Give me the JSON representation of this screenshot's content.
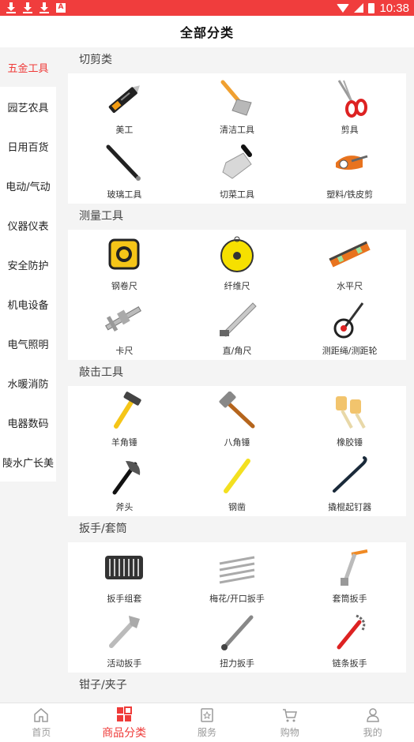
{
  "status_bar": {
    "time": "10:38",
    "notification_icons": [
      "download-icon",
      "download-icon",
      "download-icon",
      "app-a-icon"
    ],
    "accent": "#f03d3d"
  },
  "header": {
    "title": "全部分类"
  },
  "sidebar": {
    "items": [
      {
        "label": "五金工具",
        "active": true
      },
      {
        "label": "园艺农具",
        "active": false
      },
      {
        "label": "日用百货",
        "active": false
      },
      {
        "label": "电动/气动",
        "active": false
      },
      {
        "label": "仪器仪表",
        "active": false
      },
      {
        "label": "安全防护",
        "active": false
      },
      {
        "label": "机电设备",
        "active": false
      },
      {
        "label": "电气照明",
        "active": false
      },
      {
        "label": "水暖消防",
        "active": false
      },
      {
        "label": "电器数码",
        "active": false
      },
      {
        "label": "陵水广长美",
        "active": false
      }
    ]
  },
  "sections": [
    {
      "title": "切剪类",
      "items": [
        {
          "label": "美工",
          "icon": "utility-knife-icon"
        },
        {
          "label": "清洁工具",
          "icon": "scraper-icon"
        },
        {
          "label": "剪具",
          "icon": "scissors-icon"
        },
        {
          "label": "玻璃工具",
          "icon": "glass-cutter-icon"
        },
        {
          "label": "切菜工具",
          "icon": "cleaver-icon"
        },
        {
          "label": "塑料/铁皮剪",
          "icon": "pipe-cutter-icon"
        }
      ]
    },
    {
      "title": "测量工具",
      "items": [
        {
          "label": "钢卷尺",
          "icon": "tape-measure-icon"
        },
        {
          "label": "纤维尺",
          "icon": "fiber-tape-icon"
        },
        {
          "label": "水平尺",
          "icon": "spirit-level-icon"
        },
        {
          "label": "卡尺",
          "icon": "caliper-icon"
        },
        {
          "label": "直/角尺",
          "icon": "square-ruler-icon"
        },
        {
          "label": "测距绳/测距轮",
          "icon": "measuring-wheel-icon"
        }
      ]
    },
    {
      "title": "敲击工具",
      "items": [
        {
          "label": "羊角锤",
          "icon": "claw-hammer-icon"
        },
        {
          "label": "八角锤",
          "icon": "octagonal-hammer-icon"
        },
        {
          "label": "橡胶锤",
          "icon": "rubber-mallet-icon"
        },
        {
          "label": "斧头",
          "icon": "axe-icon"
        },
        {
          "label": "钢凿",
          "icon": "chisel-icon"
        },
        {
          "label": "撬棍起钉器",
          "icon": "crowbar-icon"
        }
      ]
    },
    {
      "title": "扳手/套筒",
      "items": [
        {
          "label": "扳手组套",
          "icon": "wrench-set-icon"
        },
        {
          "label": "梅花/开口扳手",
          "icon": "combination-wrench-icon"
        },
        {
          "label": "套筒扳手",
          "icon": "socket-wrench-icon"
        },
        {
          "label": "活动扳手",
          "icon": "adjustable-wrench-icon"
        },
        {
          "label": "扭力扳手",
          "icon": "torque-wrench-icon"
        },
        {
          "label": "链条扳手",
          "icon": "chain-wrench-icon"
        }
      ]
    },
    {
      "title": "钳子/夹子",
      "items": []
    }
  ],
  "bottom_nav": [
    {
      "label": "首页",
      "icon": "home-icon",
      "active": false
    },
    {
      "label": "商品分类",
      "icon": "category-icon",
      "active": true
    },
    {
      "label": "服务",
      "icon": "service-icon",
      "active": false
    },
    {
      "label": "购物",
      "icon": "cart-icon",
      "active": false
    },
    {
      "label": "我的",
      "icon": "user-icon",
      "active": false
    }
  ]
}
